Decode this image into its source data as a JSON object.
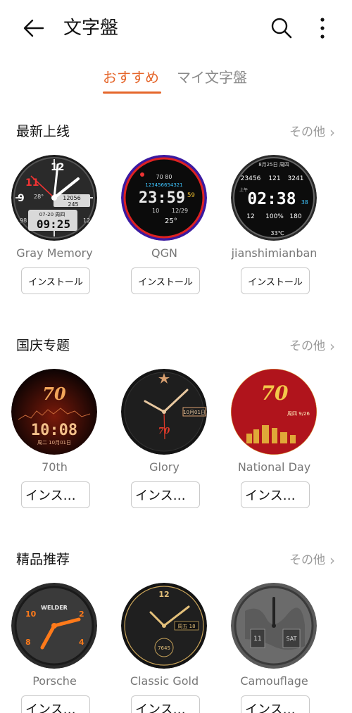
{
  "header": {
    "title": "文字盤"
  },
  "tabs": [
    {
      "label": "おすすめ",
      "active": true
    },
    {
      "label": "マイ文字盤",
      "active": false
    }
  ],
  "colors": {
    "accent": "#e5662b"
  },
  "sections": [
    {
      "title": "最新上线",
      "more": "その他",
      "items": [
        {
          "name": "Gray Memory",
          "button": "インストール",
          "face_text": {
            "date": "07-20 周四",
            "time": "09:25",
            "steps": "12056",
            "kcal": "245",
            "temp": "28°",
            "hr": "98",
            "batt": "12"
          }
        },
        {
          "name": "QGN",
          "button": "インストール",
          "face_text": {
            "top": "70  80",
            "digits": "123456654321",
            "time": "23:59",
            "sec": "59",
            "date": "12/29",
            "day": "10",
            "temp": "25°"
          }
        },
        {
          "name": "jianshimianban",
          "button": "インストール",
          "face_text": {
            "date": "8月25日 周四",
            "steps": "23456",
            "mid": "121",
            "kcal": "3241",
            "ampm": "上午",
            "time": "02:38",
            "sec": "38",
            "a": "12",
            "b": "100%",
            "c": "180",
            "temp": "33℃"
          }
        }
      ]
    },
    {
      "title": "国庆专题",
      "more": "その他",
      "items": [
        {
          "name": "70th",
          "button": "インスト...",
          "face_text": {
            "logo": "70",
            "time": "10:08",
            "date": "周二 10月01日"
          }
        },
        {
          "name": "Glory",
          "button": "インスト...",
          "face_text": {
            "date": "10月01日",
            "logo": "70"
          }
        },
        {
          "name": "National Day",
          "button": "インスト...",
          "face_text": {
            "logo": "70",
            "date": "周四 9/26"
          }
        }
      ]
    },
    {
      "title": "精品推荐",
      "more": "その他",
      "items": [
        {
          "name": "Porsche",
          "button": "インスト...",
          "face_text": {
            "brand": "WELDER",
            "n10": "10",
            "n2": "2",
            "n4": "4",
            "n8": "8"
          }
        },
        {
          "name": "Classic Gold",
          "button": "インスト...",
          "face_text": {
            "n12": "12",
            "date": "周五 18",
            "steps": "7645"
          }
        },
        {
          "name": "Camouflage",
          "button": "インスト...",
          "face_text": {
            "left": "11",
            "right": "SAT"
          }
        }
      ]
    }
  ]
}
